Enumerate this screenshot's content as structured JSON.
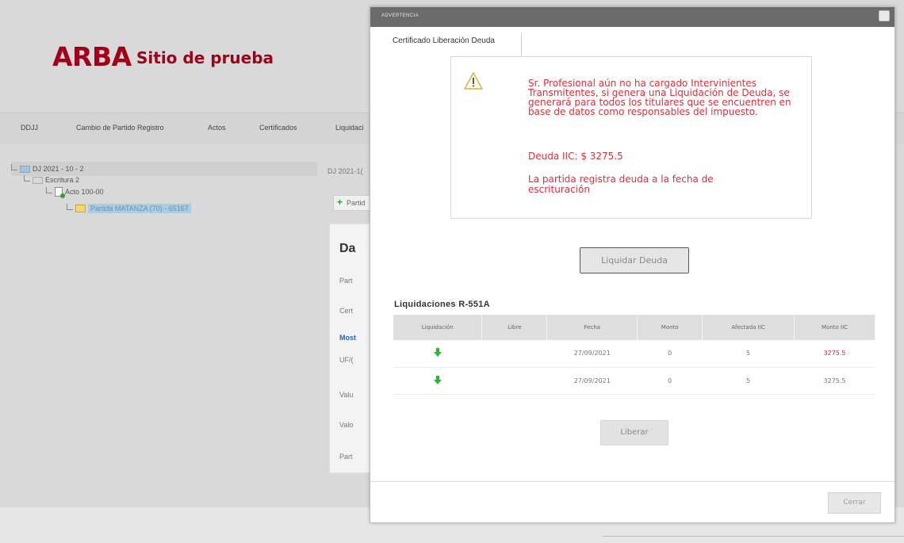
{
  "app": {
    "logo": "ARBA",
    "subtitle": "Sitio de prueba"
  },
  "nav": {
    "items": [
      "DDJJ",
      "Cambio de Partido Registro",
      "Actos",
      "Certificados",
      "Liquidaci"
    ]
  },
  "tree": {
    "root": "DJ 2021 - 10 - 2",
    "escritura": "Escritura 2",
    "acto": "Acto 100-00",
    "partida": "Partida MATANZA (70) - 65167"
  },
  "background_fragments": {
    "dj_ref": "DJ 2021-1(",
    "partida_btn": "Partid",
    "card_title": "Da",
    "row1": "Part",
    "row2": "Cert",
    "row3": "Most",
    "row4": "UF/(",
    "row5": "Valu",
    "row6": "Valo",
    "row7": "Part"
  },
  "modal": {
    "title": "ADVERTENCIA",
    "cert_title": "Certificado Liberación Deuda",
    "warning": {
      "icon": "warning-triangle-icon",
      "message": "Sr. Profesional aún no ha cargado Intervinientes Transmitentes, si genera una Liquidación de Deuda, se generará para todos los titulares que se encuentren en base de datos como responsables del impuesto.",
      "debt": "Deuda IIC: $ 3275.5",
      "note": "La partida registra deuda a la fecha de escrituración"
    },
    "liquidar_button": "Liquidar Deuda",
    "table_title": "Liquidaciones R-551A",
    "columns": [
      "Liquidación",
      "Libre",
      "Fecha",
      "Monto",
      "Afectada IIC",
      "Monto IIC"
    ],
    "rows": [
      {
        "icon": "download-icon",
        "libre": "",
        "fecha": "27/09/2021",
        "monto": "0",
        "afectada": "5",
        "monto_iic": "3275.5"
      },
      {
        "icon": "download-icon",
        "libre": "",
        "fecha": "27/09/2021",
        "monto": "0",
        "afectada": "5",
        "monto_iic": "3275.5"
      }
    ],
    "liberar_button": "Liberar",
    "cerrar_button": "Cerrar"
  },
  "colors": {
    "brand": "#a0001a",
    "warning_text": "#d9303a",
    "titlebar": "#6b6b6b",
    "download_arrow": "#2fb33a"
  }
}
